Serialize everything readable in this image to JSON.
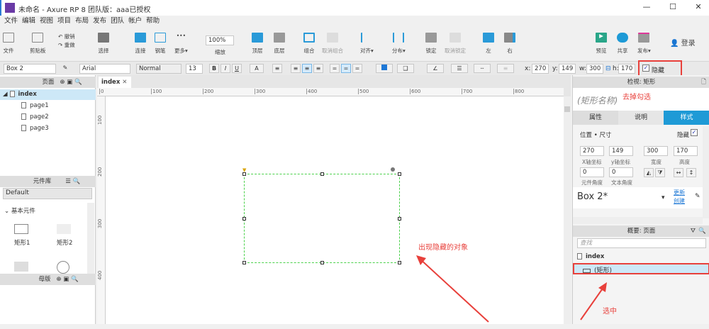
{
  "window": {
    "title": "未命名 - Axure RP 8 团队版：aaa已授权",
    "min": "—",
    "max": "☐",
    "close": "✕"
  },
  "menu": [
    "文件",
    "编辑",
    "视图",
    "项目",
    "布局",
    "发布",
    "团队",
    "帐户",
    "帮助"
  ],
  "toolbar": {
    "file": "文件",
    "clipboard": "剪贴板",
    "undo": "撤销",
    "redo": "重做",
    "select": "选择",
    "connect": "连接",
    "pen": "钢笔",
    "more": "更多▾",
    "zoom_value": "100%",
    "zoom": "缩放",
    "top": "顶层",
    "bottom": "底层",
    "group": "组合",
    "ungroup": "取消组合",
    "align": "对齐▾",
    "distribute": "分布▾",
    "lock": "锁定",
    "unlock": "取消锁定",
    "left": "左",
    "right": "右",
    "preview": "预览",
    "share": "共享",
    "publish": "发布▾",
    "login": "登录"
  },
  "format": {
    "style": "Box 2",
    "font": "Arial",
    "weight": "Normal",
    "size": "13",
    "bold": "B",
    "italic": "I",
    "underline": "U",
    "x_label": "x:",
    "x": "270",
    "y_label": "y:",
    "y": "149",
    "w_label": "w:",
    "w": "300",
    "h_label": "h:",
    "h": "170",
    "hidden_label": "隐藏",
    "hidden_checked": true
  },
  "pages": {
    "title": "页面",
    "root": "index",
    "items": [
      "page1",
      "page2",
      "page3"
    ]
  },
  "library": {
    "title": "元件库",
    "selected": "Default",
    "section": "基本元件",
    "items": [
      "矩形1",
      "矩形2"
    ]
  },
  "masters": {
    "title": "母版"
  },
  "canvas": {
    "tab": "index",
    "ruler_x": [
      "0",
      "100",
      "200",
      "300",
      "400",
      "500",
      "600",
      "700",
      "800"
    ],
    "ruler_y": [
      "100",
      "200",
      "300",
      "400"
    ],
    "annotation": "出现隐藏的对象"
  },
  "inspector": {
    "title": "检视: 矩形",
    "name_placeholder": "(矩形名称)",
    "annotation": "去掉勾选",
    "tabs": [
      "属性",
      "说明",
      "样式"
    ],
    "section": "位置 • 尺寸",
    "hidden_label": "隐藏",
    "x": "270",
    "y": "149",
    "w": "300",
    "h": "170",
    "x_label": "X轴坐标",
    "y_label": "y轴坐标",
    "w_label": "宽度",
    "h_label": "高度",
    "rot": "0",
    "text_rot": "0",
    "rot_label": "元件角度",
    "text_rot_label": "文本角度",
    "style_name": "Box 2*",
    "update": "更新",
    "create": "创建"
  },
  "outline": {
    "title": "概要: 页面",
    "search_placeholder": "查找",
    "root": "index",
    "item": "(矩形)",
    "annotation": "选中"
  },
  "colors": {
    "accent": "#1e9ad6",
    "annotation": "#e8403b",
    "selection": "#cde8f7"
  }
}
